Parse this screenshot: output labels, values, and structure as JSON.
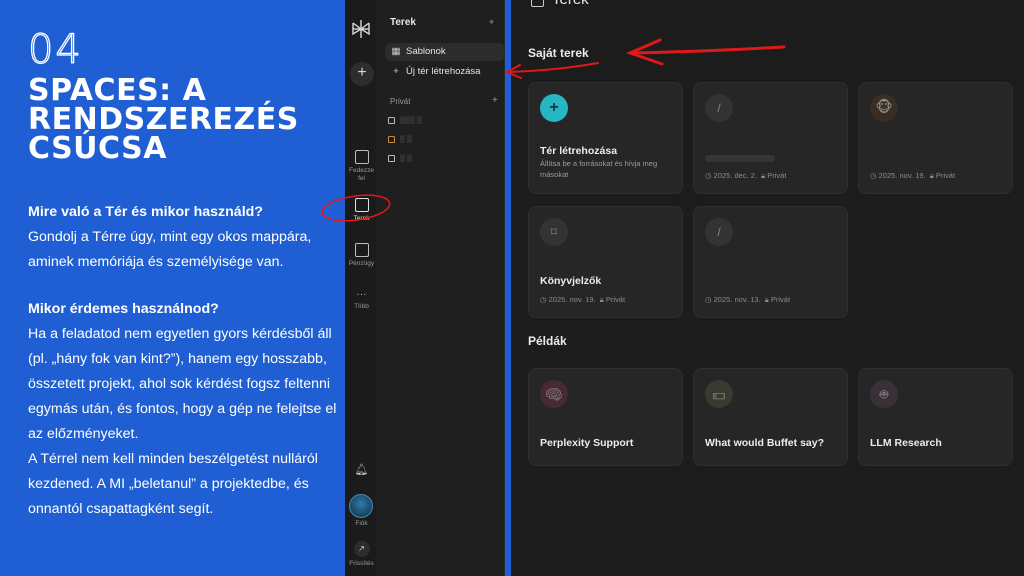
{
  "slide": {
    "number": "04",
    "title": "SPACES: A\nRENDSZEREZÉS\nCSÚCSA",
    "q1": "Mire való a Tér és mikor használd?",
    "a1": "Gondolj a Térre úgy, mint egy okos mappára, aminek memóriája és személyisége van.",
    "q2": "Mikor érdemes használnod?",
    "a2": "Ha a feladatod nem egyetlen gyors kérdésből áll (pl. „hány fok van kint?”), hanem egy hosszabb, összetett projekt, ahol sok kérdést fogsz feltenni egymás után, és fontos, hogy a gép ne felejtse el az előzményeket.",
    "a3": "A Térrel nem kell minden beszélgetést nulláról kezdened. A MI „beletanul” a projektedbe, és onnantól csapattagként segít."
  },
  "rail": {
    "discover_label": "Fedezze fel",
    "spaces_label": "Terek",
    "finance_label": "Pénzügy",
    "more_label": "Több",
    "account_label": "Fiók",
    "upgrade_label": "Frissítés"
  },
  "sidebar": {
    "title": "Terek",
    "templates_label": "Sablonok",
    "new_space_label": "Új tér létrehozása",
    "private_section": "Privát"
  },
  "main": {
    "header": "Terek",
    "my_spaces_title": "Saját terek",
    "examples_title": "Példák",
    "cards": [
      {
        "title": "Tér létrehozása",
        "desc": "Állítsa be a forrásokat és hívja meg másokat"
      },
      {
        "date": "2025. dec. 2.",
        "privacy": "Privát"
      },
      {
        "date": "2025. nov. 19.",
        "privacy": "Privát"
      },
      {
        "title": "Könyvjelzők",
        "date": "2025. nov. 19.",
        "privacy": "Privát"
      },
      {
        "date": "2025. nov. 13.",
        "privacy": "Privát"
      }
    ],
    "examples": [
      {
        "title": "Perplexity Support",
        "icon": "brain-icon"
      },
      {
        "title": "What would Buffet say?",
        "icon": "money-icon"
      },
      {
        "title": "LLM Research",
        "icon": "robot-icon"
      }
    ]
  },
  "colors": {
    "slide_blue": "#1f5fd3",
    "app_dark": "#1c1c1c",
    "teal_accent": "#27b7c3",
    "annotation_red": "#e01818"
  }
}
